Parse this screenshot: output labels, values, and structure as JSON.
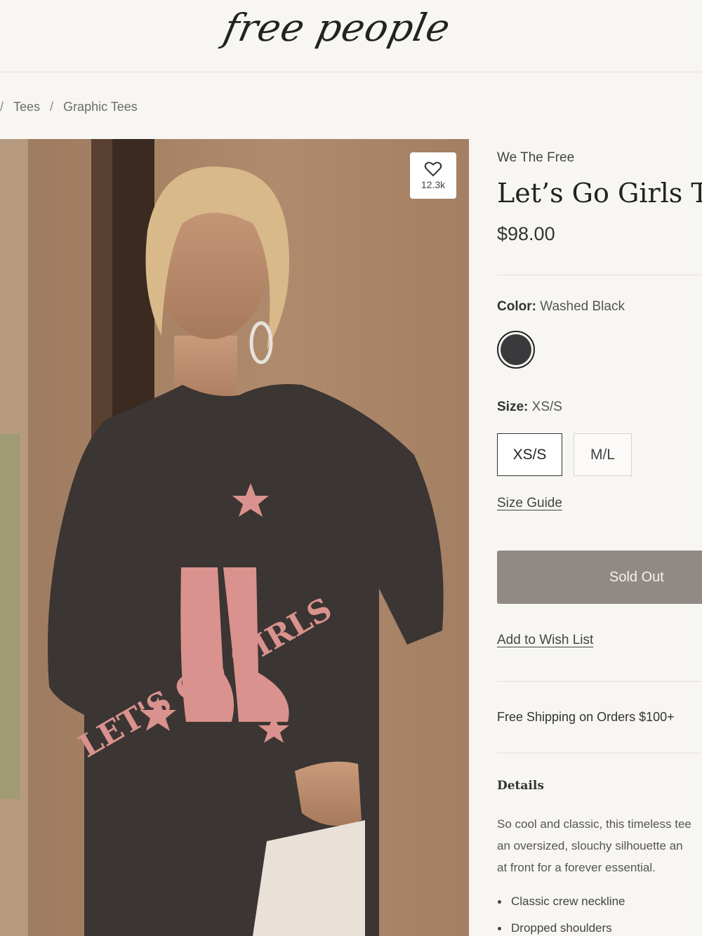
{
  "header": {
    "logo": "free people"
  },
  "breadcrumb": {
    "lead_sep": "/",
    "items": [
      "Tees",
      "Graphic Tees"
    ],
    "sep": "/"
  },
  "product": {
    "favorites_count": "12.3k",
    "shirt_graphic_text": "LET'S GO GIRLS",
    "brand": "We The Free",
    "title": "Let’s Go Girls Tee",
    "price": "$98.00",
    "color": {
      "label": "Color:",
      "value": "Washed Black",
      "swatch_color": "#3a3a3c"
    },
    "size": {
      "label": "Size:",
      "value": "XS/S",
      "options": [
        "XS/S",
        "M/L"
      ]
    },
    "size_guide": "Size Guide",
    "sold_out": "Sold Out",
    "add_to_wishlist": "Add to Wish List",
    "shipping_note": "Free Shipping on Orders $100+",
    "details_title": "Details",
    "details_lines": [
      "So cool and classic, this timeless tee",
      "an oversized, slouchy silhouette an",
      "at front for a forever essential."
    ],
    "bullets": [
      "Classic crew neckline",
      "Dropped shoulders"
    ]
  },
  "colors": {
    "background": "#f8f6f3",
    "sold_out_bg": "#918a84",
    "shirt": "#3b3533",
    "graphic": "#d9928d"
  },
  "icons": {
    "favorite": "heart-icon"
  }
}
